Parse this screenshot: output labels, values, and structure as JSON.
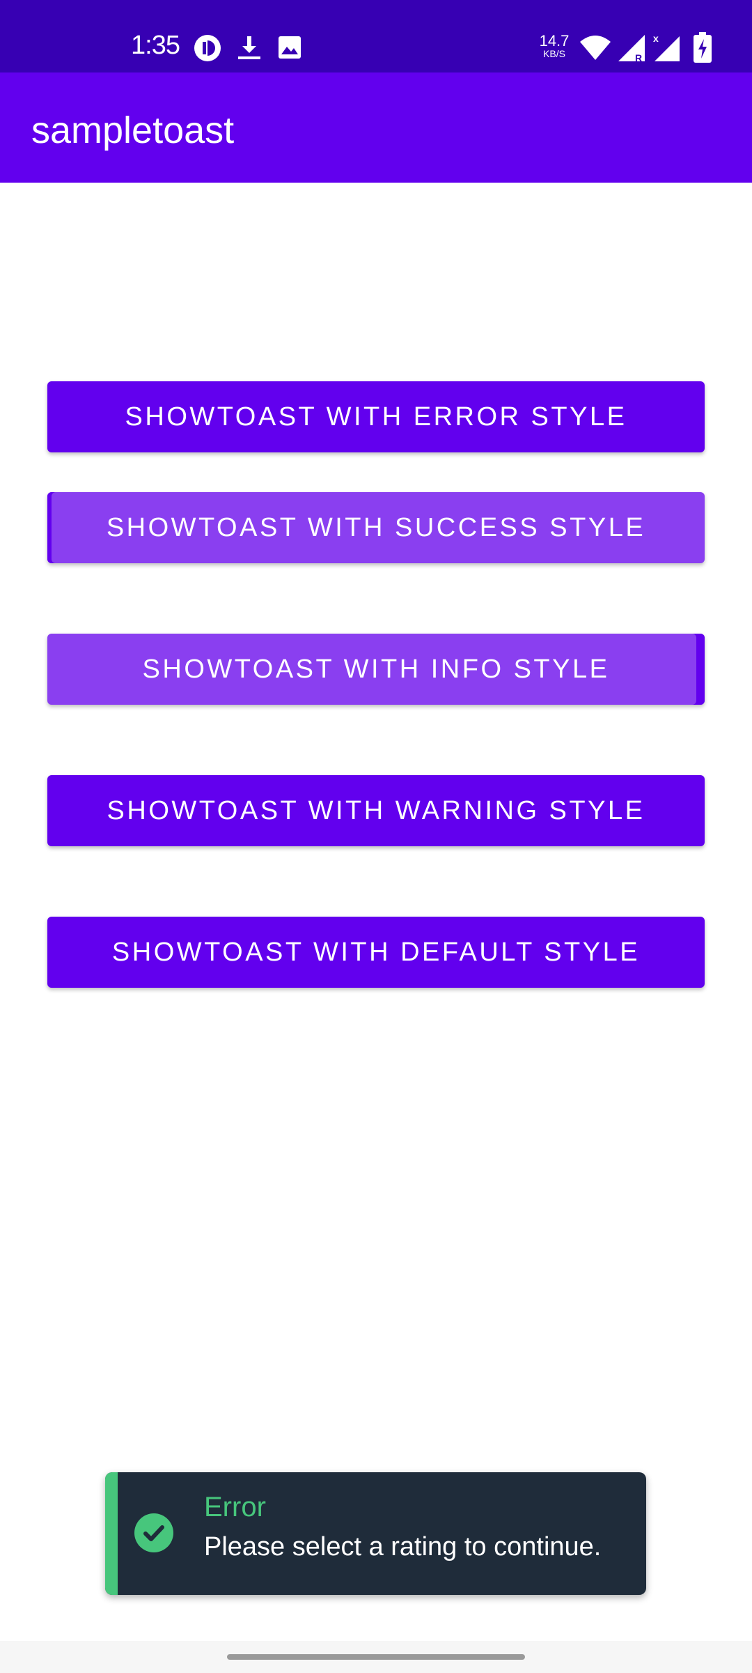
{
  "status_bar": {
    "time": "1:35",
    "net_speed_value": "14.7",
    "net_speed_unit": "KB/S",
    "icons": [
      "app-notification-icon",
      "download-icon",
      "image-icon",
      "wifi-icon",
      "signal-roaming-icon",
      "signal-icon",
      "battery-charging-icon"
    ]
  },
  "app_bar": {
    "title": "sampletoast"
  },
  "buttons": [
    {
      "label": "SHOWTOAST WITH ERROR STYLE"
    },
    {
      "label": "SHOWTOAST WITH SUCCESS STYLE"
    },
    {
      "label": "SHOWTOAST WITH INFO STYLE"
    },
    {
      "label": "SHOWTOAST WITH WARNING STYLE"
    },
    {
      "label": "SHOWTOAST WITH DEFAULT STYLE"
    }
  ],
  "toast": {
    "title": "Error",
    "message": "Please select a rating to continue.",
    "icon": "check-circle-icon"
  },
  "colors": {
    "status_bar": "#3700b3",
    "primary": "#6200ee",
    "button_pressed": "#8a3ff0",
    "toast_bg": "#1f2c3a",
    "toast_accent": "#47c67c"
  }
}
